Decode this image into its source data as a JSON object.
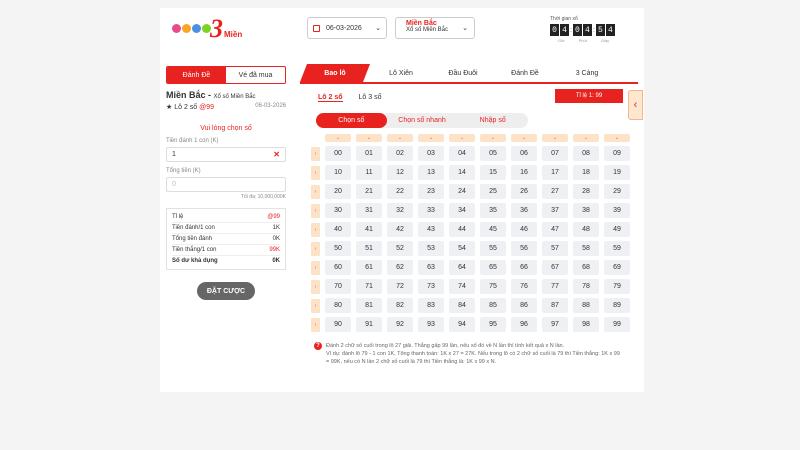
{
  "header": {
    "logo_text": "Miền",
    "logo_number": "3",
    "date_value": "06-03-2026",
    "region_title": "Miền Bắc",
    "region_sub": "Xổ số Miền Bắc",
    "timer_label": "Thời gian xổ",
    "timer_digits": [
      "0",
      "4",
      "0",
      "4",
      "5",
      "4"
    ],
    "timer_units": [
      "Giờ",
      "Phút",
      "Giây"
    ]
  },
  "left": {
    "tabs": [
      "Đánh Đề",
      "Vé đã mua"
    ],
    "title": "Miền Bắc -",
    "title_sub": "Xổ số Miền Bắc",
    "bet_type": "★ Lô 2 số",
    "bet_rate": "@99",
    "date": "06-03-2026",
    "warning": "Vui lòng chọn số",
    "label_per_unit": "Tiền đánh 1 con (K)",
    "per_unit_value": "1",
    "label_total": "Tổng tiền (K)",
    "total_placeholder": "0",
    "max_note": "Tối đa: 10,000,000K",
    "summary": [
      {
        "label": "Tỉ lệ",
        "value": "@99"
      },
      {
        "label": "Tiền đánh/1 con",
        "value": "1K"
      },
      {
        "label": "Tổng tiền đánh",
        "value": "0K"
      },
      {
        "label": "Tiền thắng/1 con",
        "value": "99K"
      },
      {
        "label": "Số dư khả dụng",
        "value": "0K"
      }
    ],
    "bet_button": "ĐẶT CƯỢC"
  },
  "main": {
    "tabs": [
      "Bao lô",
      "Lô Xiên",
      "Đầu Đuôi",
      "Đánh Đề",
      "3 Càng"
    ],
    "subtabs": [
      "Lô 2 số",
      "Lô 3 số"
    ],
    "rate_badge": "Tỉ lệ 1: 99",
    "modes": [
      "Chọn số",
      "Chọn số nhanh",
      "Nhập số"
    ],
    "numbers": [
      [
        "00",
        "01",
        "02",
        "03",
        "04",
        "05",
        "06",
        "07",
        "08",
        "09"
      ],
      [
        "10",
        "11",
        "12",
        "13",
        "14",
        "15",
        "16",
        "17",
        "18",
        "19"
      ],
      [
        "20",
        "21",
        "22",
        "23",
        "24",
        "25",
        "26",
        "27",
        "28",
        "29"
      ],
      [
        "30",
        "31",
        "32",
        "33",
        "34",
        "35",
        "36",
        "37",
        "38",
        "39"
      ],
      [
        "40",
        "41",
        "42",
        "43",
        "44",
        "45",
        "46",
        "47",
        "48",
        "49"
      ],
      [
        "50",
        "51",
        "52",
        "53",
        "54",
        "55",
        "56",
        "57",
        "58",
        "59"
      ],
      [
        "60",
        "61",
        "62",
        "63",
        "64",
        "65",
        "66",
        "67",
        "68",
        "69"
      ],
      [
        "70",
        "71",
        "72",
        "73",
        "74",
        "75",
        "76",
        "77",
        "78",
        "79"
      ],
      [
        "80",
        "81",
        "82",
        "83",
        "84",
        "85",
        "86",
        "87",
        "88",
        "89"
      ],
      [
        "90",
        "91",
        "92",
        "93",
        "94",
        "95",
        "96",
        "97",
        "98",
        "99"
      ]
    ],
    "note_line1": "Đánh 2 chữ số cuối trong lô 27 giải. Thắng gấp 99 lần, nếu số đó về N lần thì tính kết quả x N lần.",
    "note_line2": "Ví dụ: đánh lô 79 - 1 con 1K, Tổng thanh toán: 1K x 27 = 27K. Nếu trong lô có 2 chữ số cuối là 79 thì Tiền thắng: 1K x 99 = 99K, nếu có N lần 2 chữ số cuối là 79 thì Tiền thắng là: 1K x 99 x N."
  }
}
